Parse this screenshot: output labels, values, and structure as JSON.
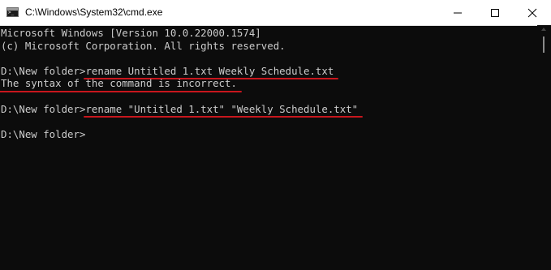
{
  "window": {
    "title": "C:\\Windows\\System32\\cmd.exe",
    "icon": "cmd-icon",
    "controls": [
      "minimize-icon",
      "maximize-icon",
      "close-icon"
    ]
  },
  "terminal": {
    "lines": [
      {
        "text": "Microsoft Windows [Version 10.0.22000.1574]"
      },
      {
        "text": "(c) Microsoft Corporation. All rights reserved."
      },
      {
        "text": ""
      },
      {
        "prompt": "D:\\New folder>",
        "command": "rename Untitled 1.txt Weekly Schedule.txt"
      },
      {
        "text": "The syntax of the command is incorrect."
      },
      {
        "text": ""
      },
      {
        "prompt": "D:\\New folder>",
        "command": "rename \"Untitled 1.txt\" \"Weekly Schedule.txt\""
      },
      {
        "text": ""
      },
      {
        "prompt": "D:\\New folder>",
        "command": ""
      }
    ]
  },
  "colors": {
    "background": "#0c0c0c",
    "foreground": "#cccccc",
    "annotation_underline": "#c8161d",
    "titlebar": "#ffffff"
  }
}
